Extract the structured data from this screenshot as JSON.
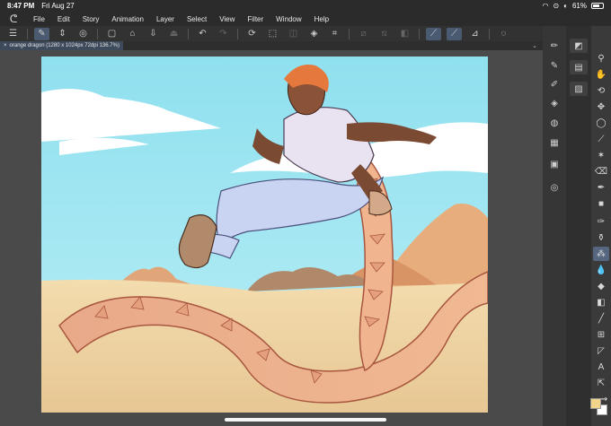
{
  "status": {
    "time": "8:47 PM",
    "date": "Fri Aug 27",
    "battery": "61%"
  },
  "menu": {
    "items": [
      "File",
      "Edit",
      "Story",
      "Animation",
      "Layer",
      "Select",
      "View",
      "Filter",
      "Window",
      "Help"
    ]
  },
  "document": {
    "tab_label": "orange dragon (1280 x 1024px 72dpi 136.7%)"
  },
  "colors": {
    "main": "#f2d48a",
    "sub": "#ffffff",
    "accent": "#4a5a70",
    "sky": "#9fe3f0",
    "sand": "#ecd6a6"
  }
}
